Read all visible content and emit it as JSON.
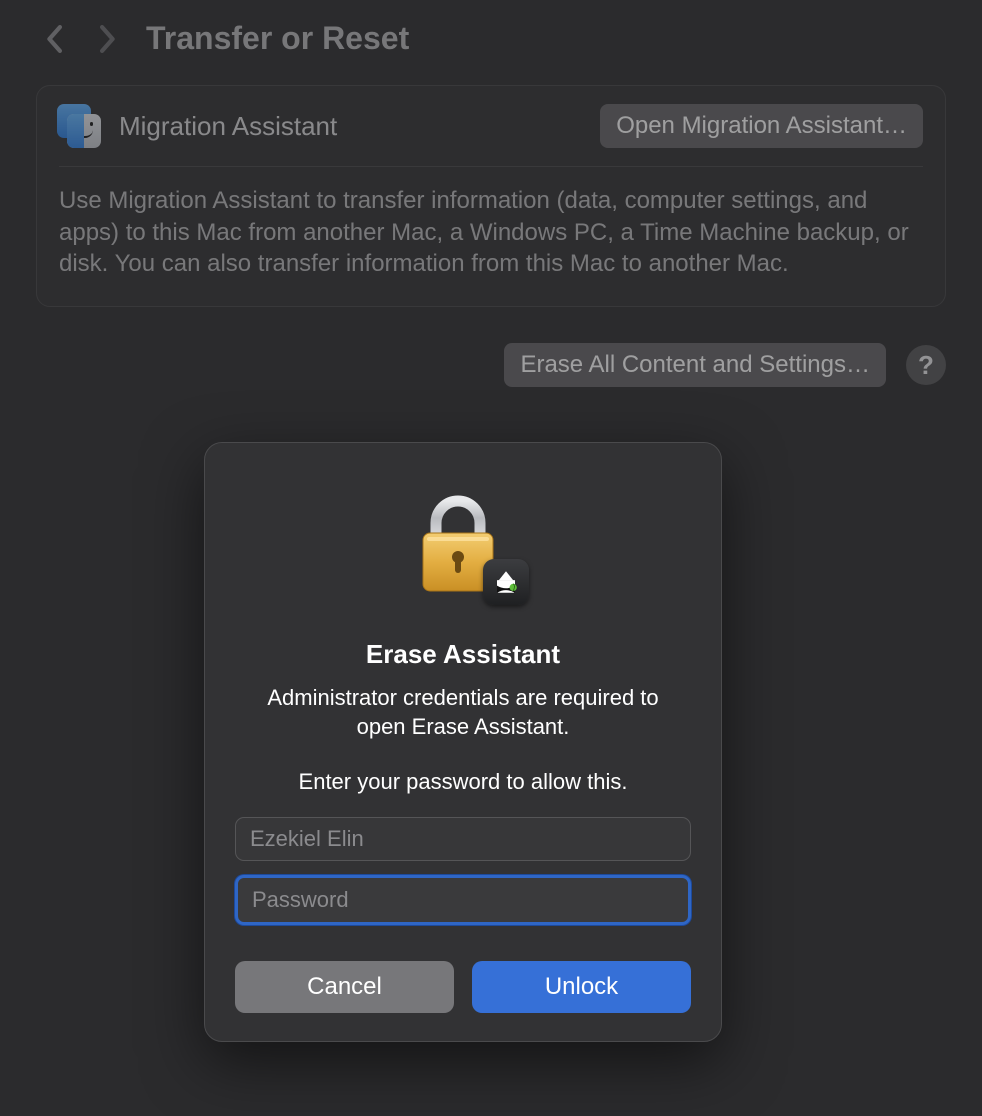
{
  "header": {
    "title": "Transfer or Reset"
  },
  "migration_card": {
    "title": "Migration Assistant",
    "open_button": "Open Migration Assistant…",
    "description": "Use Migration Assistant to transfer information (data, computer settings, and apps) to this Mac from another Mac, a Windows PC, a Time Machine backup, or disk. You can also transfer information from this Mac to another Mac."
  },
  "erase_row": {
    "button": "Erase All Content and Settings…",
    "help": "?"
  },
  "auth_dialog": {
    "title": "Erase Assistant",
    "subtitle": "Administrator credentials are required to open Erase Assistant.",
    "prompt": "Enter your password to allow this.",
    "username": "Ezekiel Elin",
    "password_placeholder": "Password",
    "cancel": "Cancel",
    "unlock": "Unlock"
  }
}
